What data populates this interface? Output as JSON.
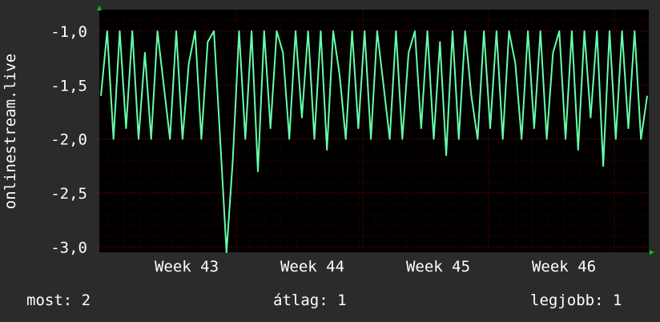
{
  "chart_data": {
    "type": "line",
    "ylabel": "onlinestream.live",
    "ylim": [
      -3.05,
      -0.8
    ],
    "y_ticks": [
      "-1,0",
      "-1,5",
      "-2,0",
      "-2,5",
      "-3,0"
    ],
    "x_tick_labels": [
      "Week 43",
      "Week 44",
      "Week 45",
      "Week 46"
    ],
    "colors": {
      "background": "#2b2b2b",
      "plot_area": "#000000",
      "series": "#66ffaa",
      "grid": "#ff0000",
      "text": "#ffffff"
    },
    "grid": true,
    "series": [
      {
        "x": [
          0,
          0.5,
          1,
          1.5,
          2,
          2.5,
          3,
          3.5,
          4,
          4.5,
          5,
          5.5,
          6,
          6.5,
          7,
          7.5,
          8,
          8.5,
          9,
          9.5,
          10,
          10.5,
          11,
          11.5,
          12,
          12.5,
          13,
          13.5,
          14,
          14.5,
          15,
          15.5,
          16,
          16.5,
          17,
          17.5,
          18,
          18.5,
          19,
          19.5,
          20,
          20.5,
          21,
          21.5,
          22,
          22.5,
          23,
          23.5,
          24,
          24.5,
          25,
          25.5,
          26,
          26.5,
          27,
          27.5,
          28,
          28.5,
          29,
          29.5,
          30,
          30.5,
          31,
          31.5,
          32,
          32.5,
          33,
          33.5,
          34,
          34.5,
          35,
          35.5,
          36,
          36.5,
          37,
          37.5,
          38,
          38.5,
          39,
          39.5,
          40,
          40.5,
          41,
          41.5,
          42,
          42.5,
          43,
          43.5
        ],
        "values": [
          -1.6,
          -1,
          -2,
          -1,
          -1.9,
          -1,
          -2,
          -1.2,
          -2,
          -1,
          -1.5,
          -2,
          -1,
          -2,
          -1.3,
          -1,
          -2,
          -1.1,
          -1,
          -2,
          -3.05,
          -2.2,
          -1,
          -2,
          -1,
          -2.3,
          -1,
          -1.9,
          -1,
          -1.2,
          -2,
          -1,
          -1.8,
          -1,
          -2,
          -1,
          -2.1,
          -1,
          -1.4,
          -2,
          -1,
          -1.9,
          -1,
          -2,
          -1,
          -1.5,
          -2,
          -1,
          -2,
          -1.2,
          -1,
          -1.9,
          -1,
          -2,
          -1.1,
          -2.15,
          -1,
          -2,
          -1,
          -1.6,
          -2,
          -1,
          -1.9,
          -1,
          -2,
          -1,
          -1.3,
          -2,
          -1,
          -1.9,
          -1,
          -2,
          -1.2,
          -1,
          -2,
          -1,
          -2.1,
          -1,
          -1.8,
          -1,
          -2.25,
          -1,
          -2,
          -1,
          -1.9,
          -1,
          -2,
          -1.6
        ]
      }
    ],
    "legend_stats": [
      {
        "label": "most:",
        "value": "2"
      },
      {
        "label": "átlag:",
        "value": "1"
      },
      {
        "label": "legjobb:",
        "value": "1"
      }
    ]
  }
}
